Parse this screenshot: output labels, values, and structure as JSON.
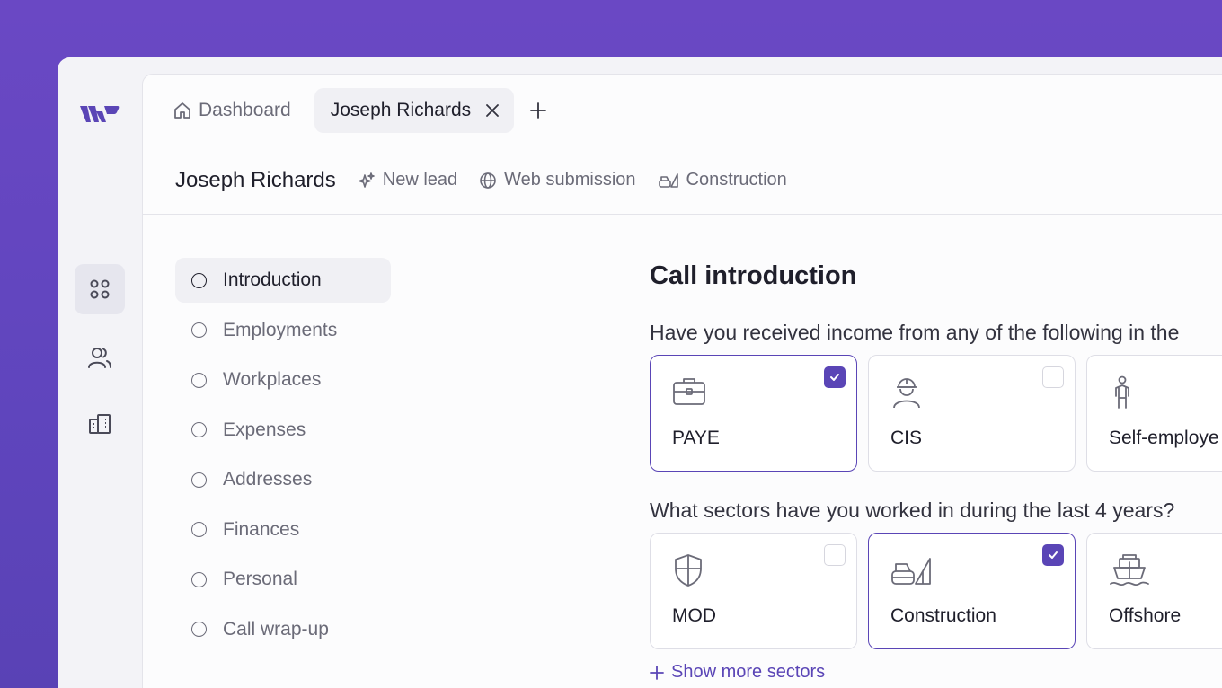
{
  "nav": {
    "logo": "logo",
    "items": [
      {
        "icon": "grid-icon",
        "active": true
      },
      {
        "icon": "users-icon",
        "active": false
      },
      {
        "icon": "building-icon",
        "active": false
      }
    ]
  },
  "tabs": {
    "dashboard_label": "Dashboard",
    "active_label": "Joseph Richards"
  },
  "header": {
    "title": "Joseph Richards",
    "tags": [
      "New lead",
      "Web submission",
      "Construction"
    ]
  },
  "steps": [
    "Introduction",
    "Employments",
    "Workplaces",
    "Expenses",
    "Addresses",
    "Finances",
    "Personal",
    "Call wrap-up"
  ],
  "content": {
    "title": "Call introduction",
    "question1": "Have you received income from any of the following in the",
    "income_options": [
      {
        "label": "PAYE",
        "icon": "briefcase-icon",
        "checked": true
      },
      {
        "label": "CIS",
        "icon": "hardhat-worker-icon",
        "checked": false
      },
      {
        "label": "Self-employe",
        "icon": "person-icon",
        "checked": false
      }
    ],
    "question2": "What sectors have you worked in during the last 4 years?",
    "sector_options": [
      {
        "label": "MOD",
        "icon": "shield-icon",
        "checked": false
      },
      {
        "label": "Construction",
        "icon": "construction-icon",
        "checked": true
      },
      {
        "label": "Offshore",
        "icon": "ship-icon",
        "checked": false
      }
    ],
    "show_more": "Show more sectors"
  },
  "colors": {
    "accent": "#5a45b6",
    "background": "#6a48c4"
  }
}
